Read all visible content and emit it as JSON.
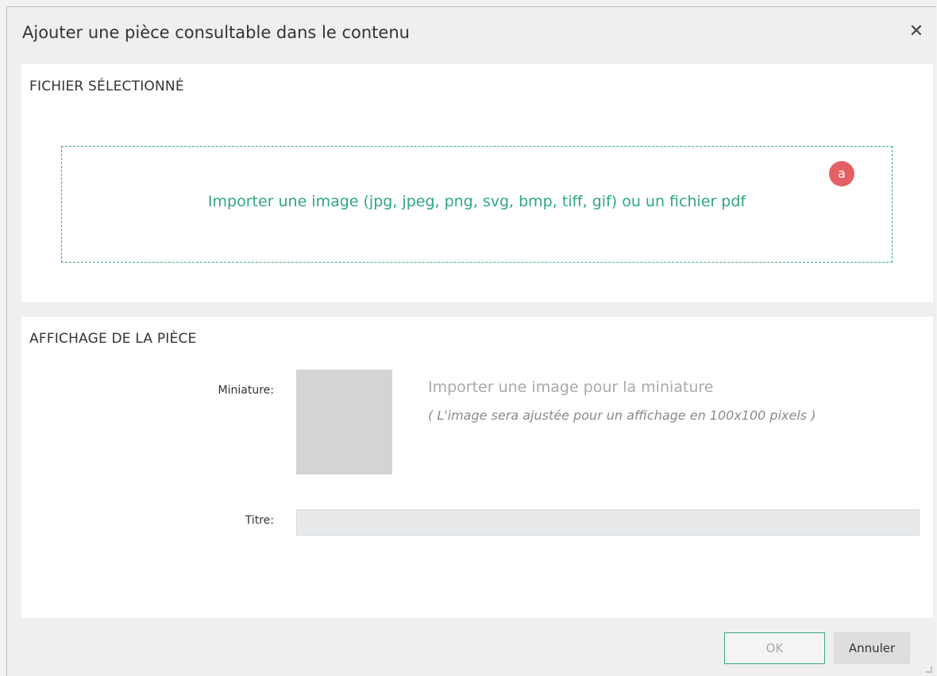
{
  "dialog": {
    "title": "Ajouter une pièce consultable dans le contenu",
    "close_symbol": "✕",
    "close_icon": "close-icon"
  },
  "file_section": {
    "heading": "FICHIER SÉLECTIONNÉ",
    "dropzone_text": "Importer une image (jpg, jpeg, png, svg, bmp, tiff, gif) ou un fichier pdf",
    "badge": "a"
  },
  "display_section": {
    "heading": "AFFICHAGE DE LA PIÈCE",
    "thumbnail_label": "Miniature:",
    "thumbnail_import": "Importer une image pour la miniature",
    "thumbnail_hint": "( L'image sera ajustée pour un affichage en 100x100 pixels )",
    "title_label": "Titre:",
    "title_value": "",
    "title_placeholder": ""
  },
  "footer": {
    "ok_label": "OK",
    "cancel_label": "Annuler"
  },
  "colors": {
    "accent": "#2ea587",
    "badge": "#e36164",
    "background": "#efefef",
    "panel": "#ffffff"
  }
}
